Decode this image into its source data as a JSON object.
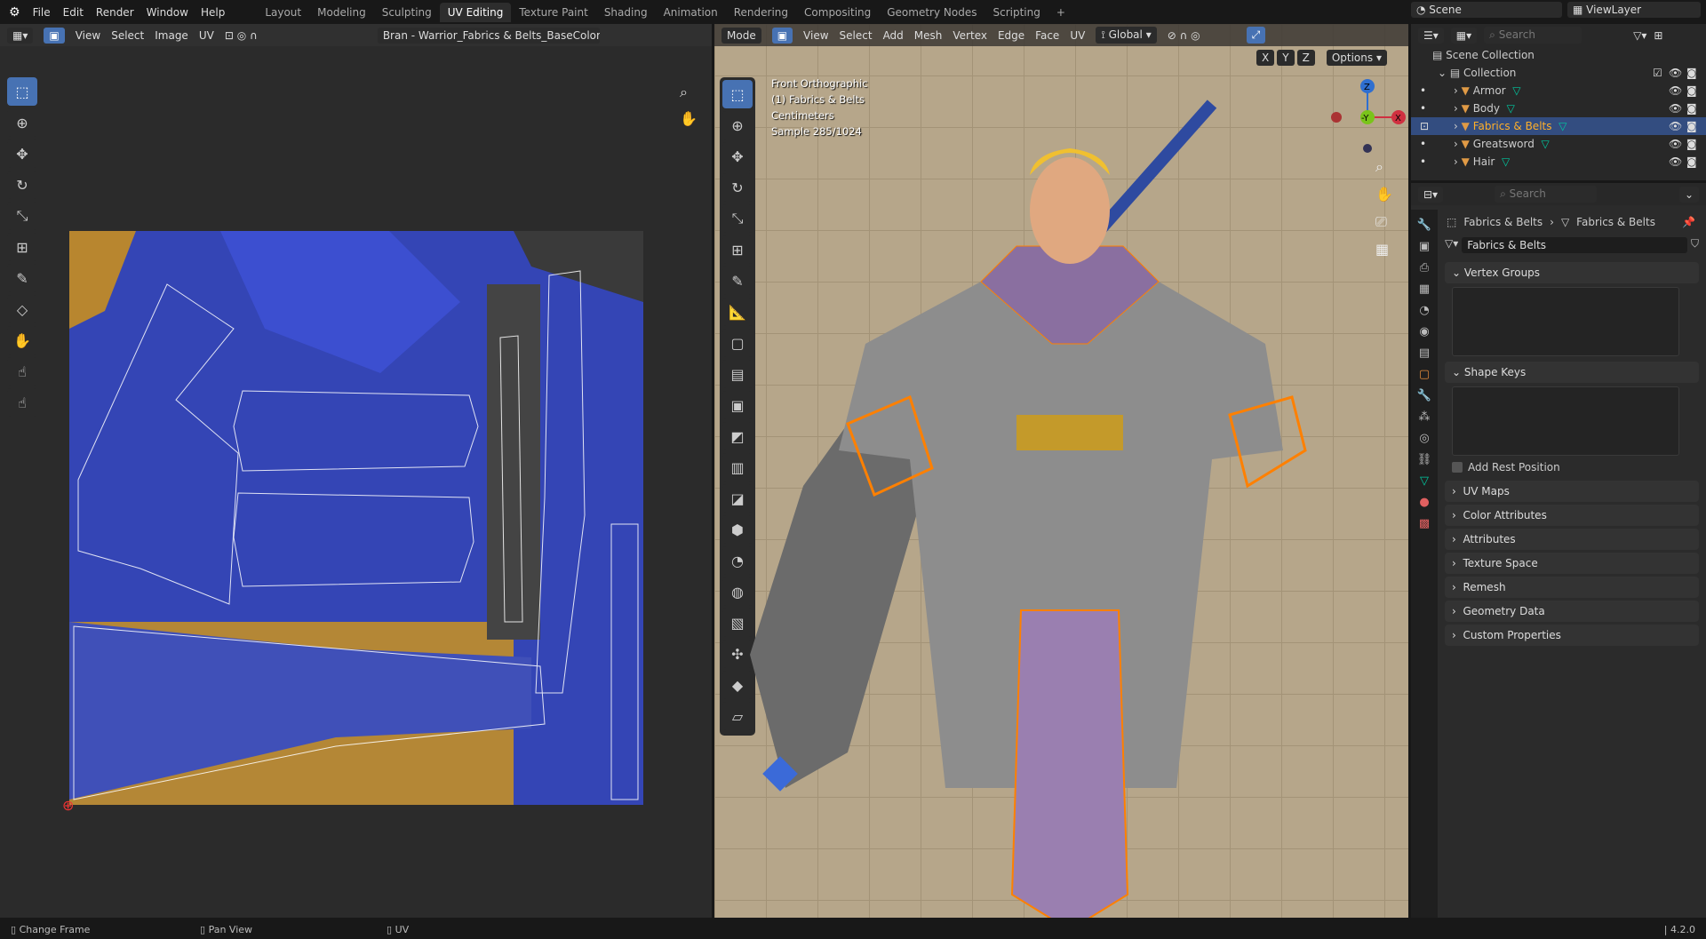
{
  "menu": [
    "File",
    "Edit",
    "Render",
    "Window",
    "Help"
  ],
  "workspaces": [
    "Layout",
    "Modeling",
    "Sculpting",
    "UV Editing",
    "Texture Paint",
    "Shading",
    "Animation",
    "Rendering",
    "Compositing",
    "Geometry Nodes",
    "Scripting"
  ],
  "active_workspace": "UV Editing",
  "uv_editor": {
    "menus": [
      "View",
      "Select",
      "Image",
      "UV"
    ],
    "image_name": "Bran - Warrior_Fabrics & Belts_BaseColor.png"
  },
  "viewport": {
    "mode": "Mode",
    "menus": [
      "View",
      "Select",
      "Add",
      "Mesh",
      "Vertex",
      "Edge",
      "Face",
      "UV"
    ],
    "orientation": "Global",
    "axes": [
      "X",
      "Y",
      "Z"
    ],
    "options": "Options",
    "overlay": [
      "Front Orthographic",
      "(1) Fabrics & Belts",
      "Centimeters",
      "Sample 285/1024"
    ],
    "gizmo": {
      "z": "Z",
      "y": "-Y",
      "x": "X"
    }
  },
  "scene": {
    "name": "Scene",
    "view_layer": "ViewLayer"
  },
  "outliner": {
    "search_placeholder": "Search",
    "root": "Scene Collection",
    "collection": "Collection",
    "items": [
      "Armor",
      "Body",
      "Fabrics & Belts",
      "Greatsword",
      "Hair"
    ],
    "selected": "Fabrics & Belts"
  },
  "properties": {
    "search_placeholder": "Search",
    "breadcrumb": [
      "Fabrics & Belts",
      "Fabrics & Belts"
    ],
    "mesh_name": "Fabrics & Belts",
    "panels": {
      "vertex_groups": "Vertex Groups",
      "shape_keys": "Shape Keys",
      "add_rest_position": "Add Rest Position",
      "collapsed": [
        "UV Maps",
        "Color Attributes",
        "Attributes",
        "Texture Space",
        "Remesh",
        "Geometry Data",
        "Custom Properties"
      ]
    }
  },
  "status": {
    "items": [
      "Change Frame",
      "Pan View",
      "UV"
    ],
    "version": "4.2.0"
  },
  "colors": {
    "accent": "#4772b3",
    "selected_text": "#ffaf29",
    "mesh_icon": "#00c8a0",
    "object_icon": "#e09a45",
    "wire": "#ff8000"
  }
}
